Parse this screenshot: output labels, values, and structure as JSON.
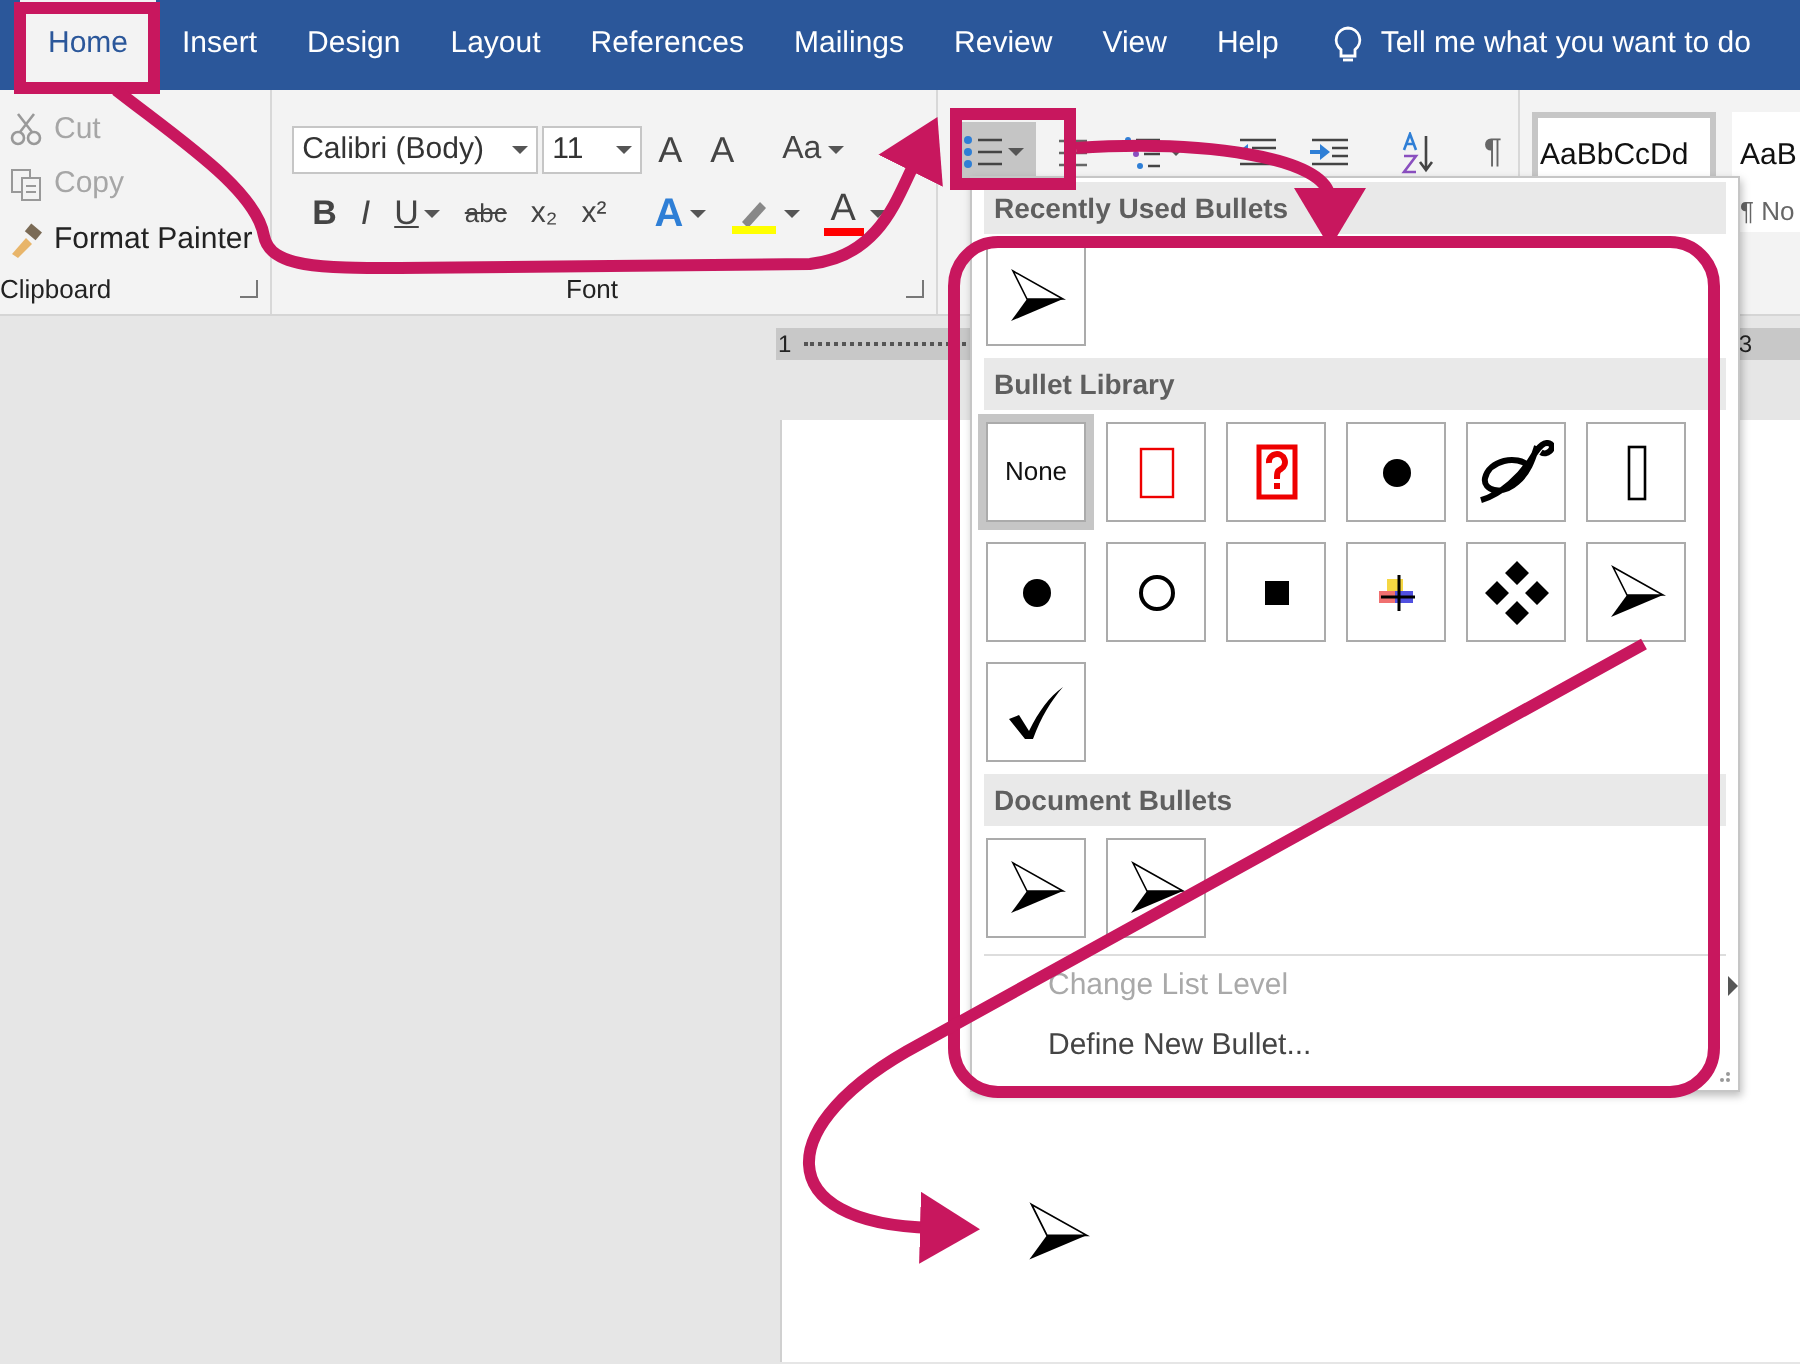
{
  "tabs": [
    {
      "label": "Home",
      "selected": true
    },
    {
      "label": "Insert",
      "selected": false
    },
    {
      "label": "Design",
      "selected": false
    },
    {
      "label": "Layout",
      "selected": false
    },
    {
      "label": "References",
      "selected": false
    },
    {
      "label": "Mailings",
      "selected": false
    },
    {
      "label": "Review",
      "selected": false
    },
    {
      "label": "View",
      "selected": false
    },
    {
      "label": "Help",
      "selected": false
    }
  ],
  "tell_me": "Tell me what you want to do",
  "clipboard": {
    "label": "Clipboard",
    "items": [
      {
        "kind": "cut",
        "label": "Cut",
        "disabled": true
      },
      {
        "kind": "copy",
        "label": "Copy",
        "disabled": true
      },
      {
        "kind": "painter",
        "label": "Format Painter",
        "disabled": false
      }
    ]
  },
  "font": {
    "label": "Font",
    "font_name": "Calibri (Body)",
    "font_size": "11",
    "size_buttons": [
      "A",
      "A",
      "Aa"
    ],
    "format_buttons": [
      "B",
      "I",
      "U",
      "abc",
      "x₂",
      "x²"
    ],
    "effects_glyph": "A",
    "color_glyph": "A"
  },
  "paragraph": {
    "bullets_selected": true,
    "pilcrow": "¶"
  },
  "styles": [
    {
      "sample": "AaBbCcDd",
      "selected": true
    },
    {
      "sample": "AaB",
      "name": "¶ No",
      "selected": false
    }
  ],
  "ruler": [
    "1",
    "3"
  ],
  "bullet_menu": {
    "sections": [
      {
        "title": "Recently Used Bullets",
        "bullets": [
          {
            "kind": "arrowhead",
            "selected": false
          }
        ]
      },
      {
        "title": "Bullet Library",
        "bullets": [
          {
            "kind": "none",
            "label": "None",
            "selected": true
          },
          {
            "kind": "red-box",
            "selected": false
          },
          {
            "kind": "red-question",
            "selected": false
          },
          {
            "kind": "dot",
            "selected": false
          },
          {
            "kind": "swirl",
            "selected": false
          },
          {
            "kind": "tall-box",
            "selected": false
          },
          {
            "kind": "dot",
            "selected": false
          },
          {
            "kind": "circle",
            "selected": false
          },
          {
            "kind": "square",
            "selected": false
          },
          {
            "kind": "cross",
            "selected": false
          },
          {
            "kind": "diamonds",
            "selected": false
          },
          {
            "kind": "arrowhead",
            "selected": false
          },
          {
            "kind": "check",
            "selected": false
          }
        ]
      },
      {
        "title": "Document Bullets",
        "bullets": [
          {
            "kind": "arrowhead",
            "selected": false
          },
          {
            "kind": "arrowhead",
            "selected": false
          }
        ]
      }
    ],
    "commands": [
      {
        "label": "Change List Level",
        "disabled": true,
        "submenu": true
      },
      {
        "label": "Define New Bullet...",
        "disabled": false,
        "submenu": false
      }
    ]
  },
  "document": {
    "bullet": {
      "kind": "arrowhead"
    }
  }
}
